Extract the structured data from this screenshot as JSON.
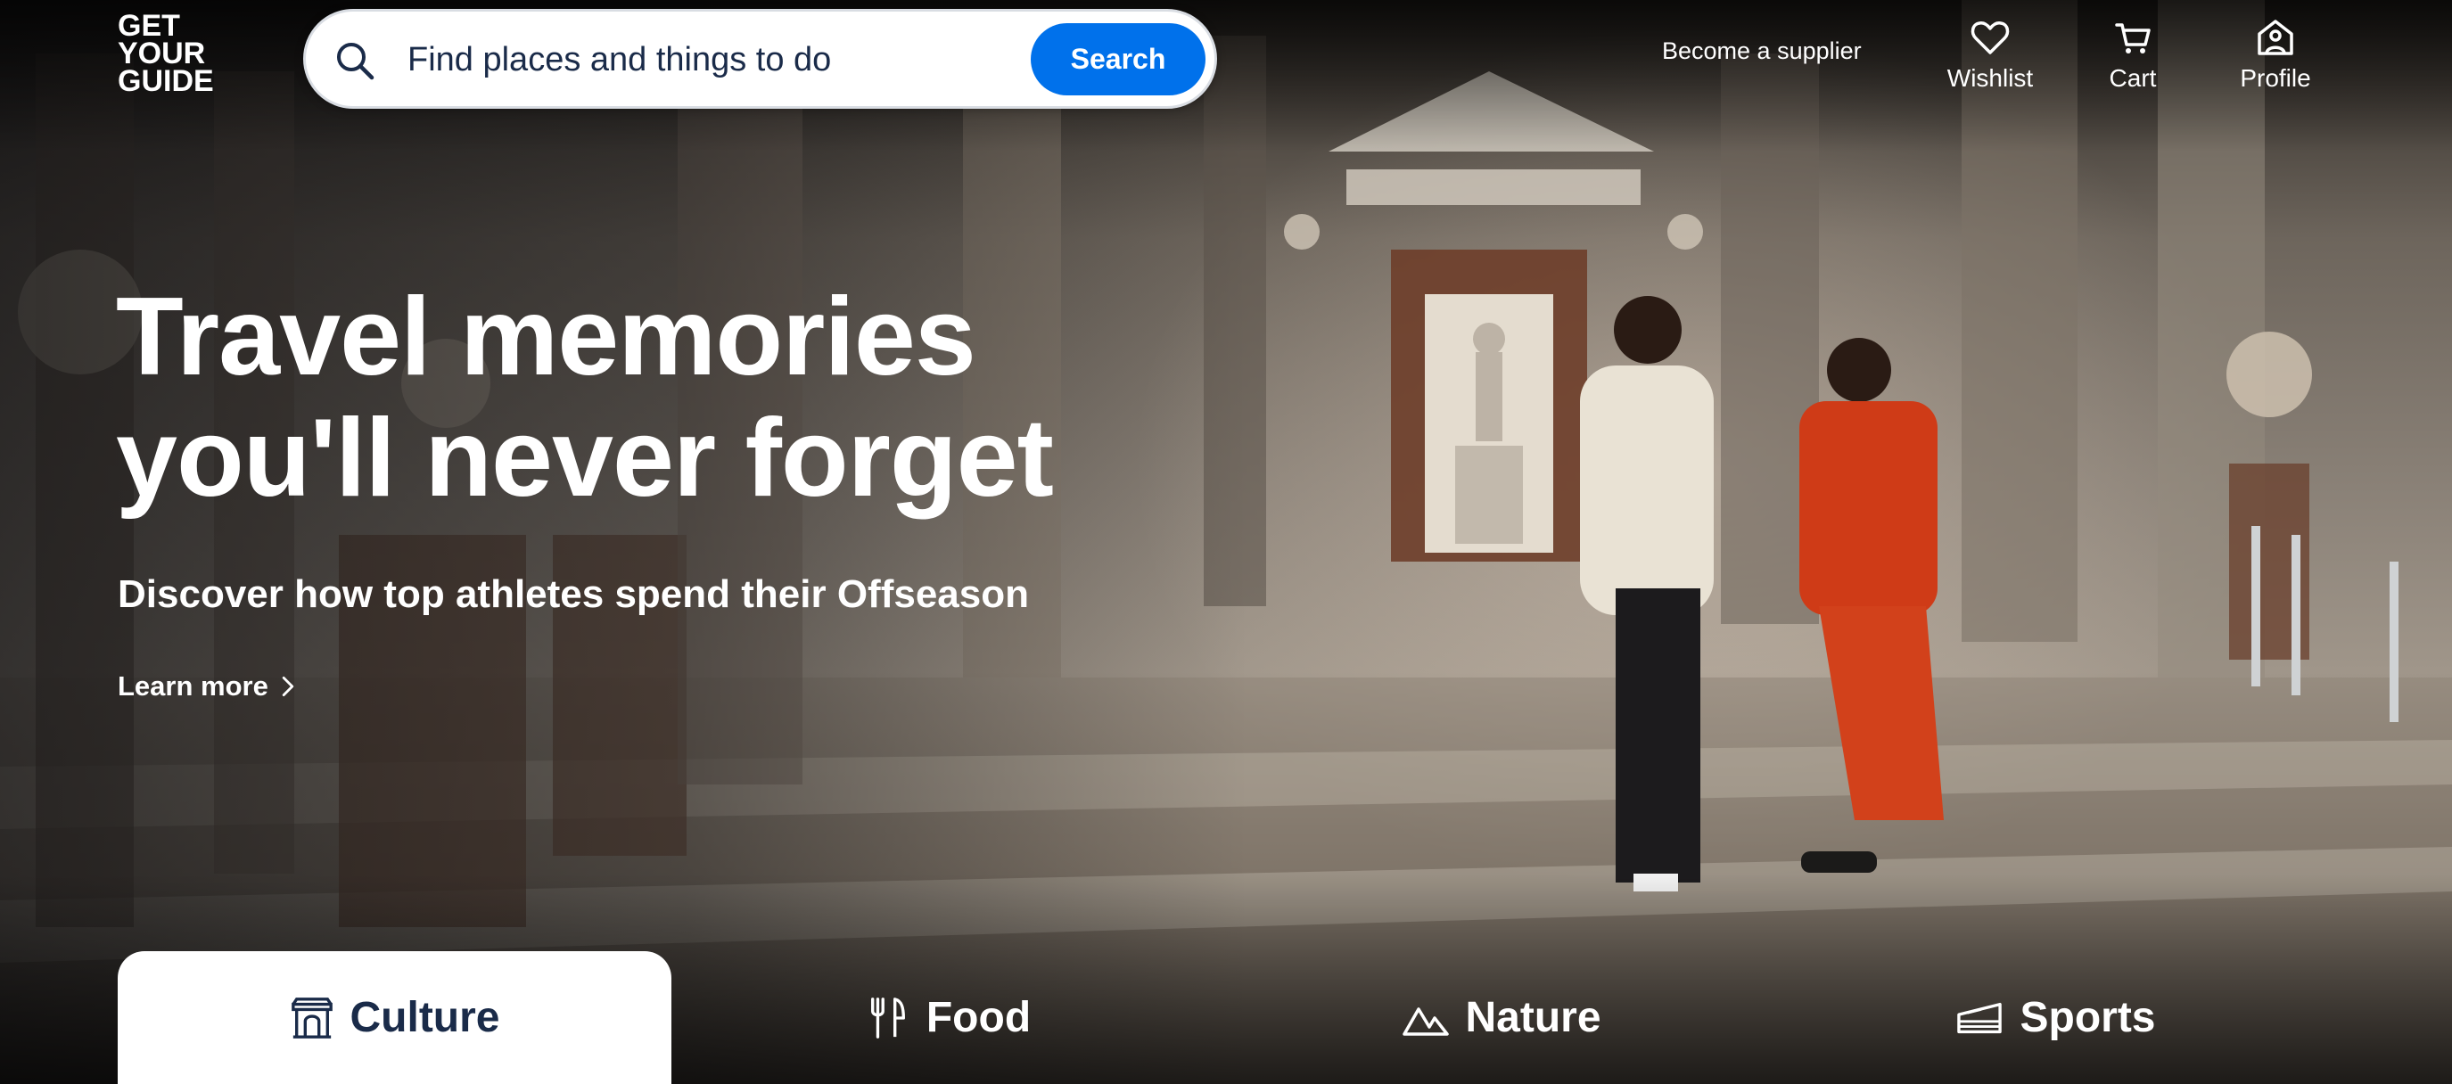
{
  "brand": {
    "logo_lines": [
      "GET",
      "YOUR",
      "GUIDE"
    ]
  },
  "search": {
    "placeholder": "Find places and things to do",
    "button_label": "Search"
  },
  "header": {
    "supplier_link": "Become a supplier",
    "nav": [
      {
        "label": "Wishlist",
        "icon": "heart-icon"
      },
      {
        "label": "Cart",
        "icon": "cart-icon"
      },
      {
        "label": "Profile",
        "icon": "profile-icon"
      }
    ]
  },
  "hero": {
    "headline_line1": "Travel memories",
    "headline_line2": "you'll never forget",
    "subheadline": "Discover how top athletes spend their Offseason",
    "cta_label": "Learn more"
  },
  "tabs": [
    {
      "label": "Culture",
      "icon": "museum-icon",
      "active": true
    },
    {
      "label": "Food",
      "icon": "fork-knife-icon",
      "active": false
    },
    {
      "label": "Nature",
      "icon": "mountain-icon",
      "active": false
    },
    {
      "label": "Sports",
      "icon": "stadium-icon",
      "active": false
    }
  ],
  "colors": {
    "accent": "#0071eb",
    "text_dark": "#1a2b49",
    "white": "#ffffff"
  }
}
